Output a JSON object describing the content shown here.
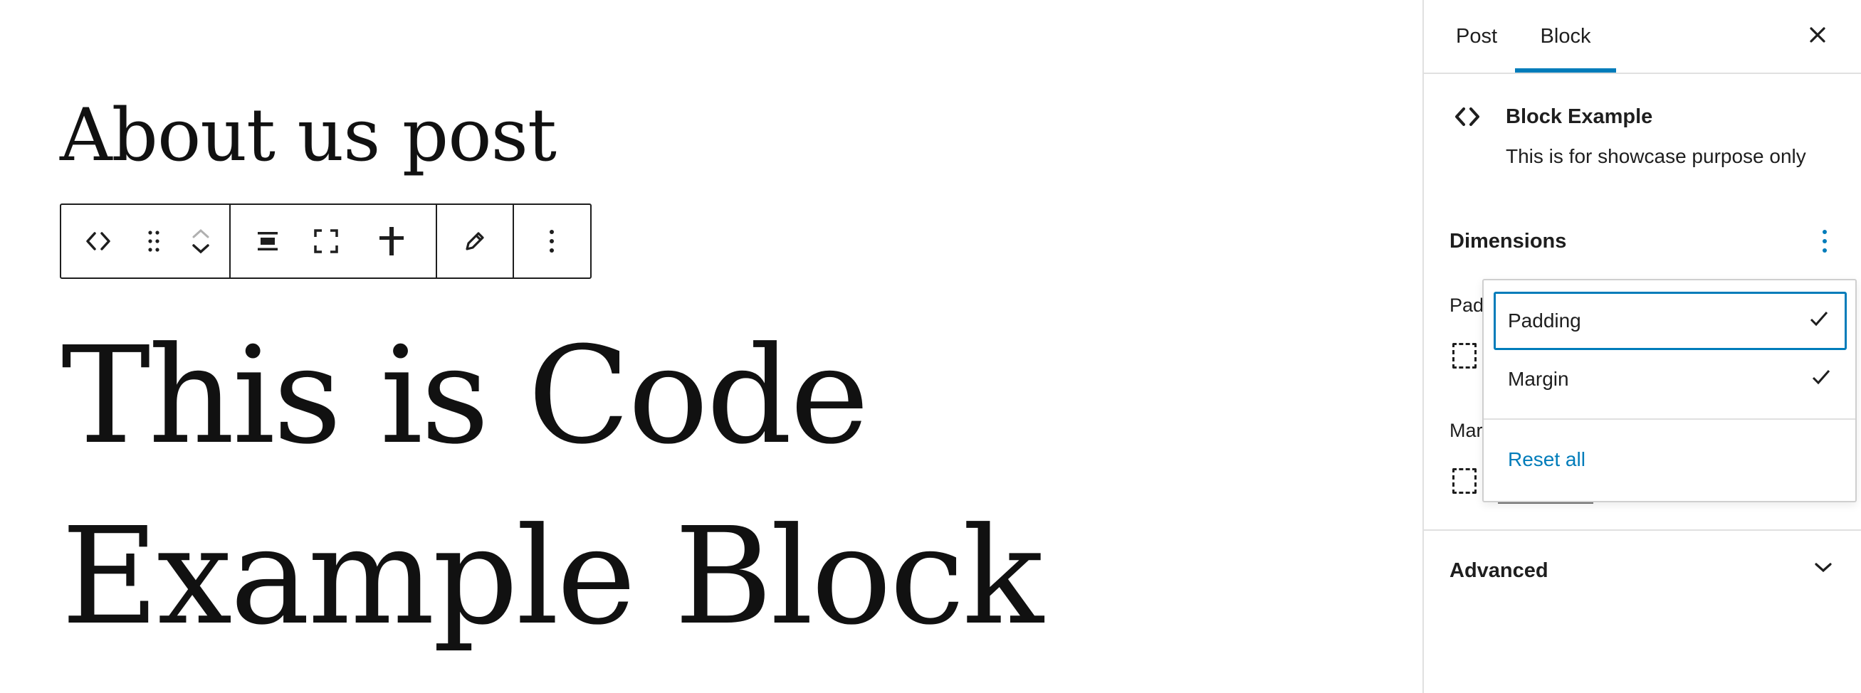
{
  "editor": {
    "post_title": "About us post",
    "heading_text": "This is Code Example Block"
  },
  "toolbar": {
    "buttons": [
      {
        "name": "block-type",
        "icon": "code-icon"
      },
      {
        "name": "drag",
        "icon": "drag-handle-icon"
      },
      {
        "name": "move",
        "icon": "chevron-up-down-icon"
      },
      {
        "name": "align",
        "icon": "align-center-icon"
      },
      {
        "name": "full-width",
        "icon": "fullscreen-icon"
      },
      {
        "name": "justify",
        "icon": "justify-icon"
      },
      {
        "name": "edit",
        "icon": "pencil-icon"
      },
      {
        "name": "options",
        "icon": "more-vertical-icon"
      }
    ]
  },
  "sidebar": {
    "tabs": [
      {
        "label": "Post",
        "active": false
      },
      {
        "label": "Block",
        "active": true
      }
    ],
    "close_icon": "close-icon",
    "block_card": {
      "icon": "code-icon",
      "title": "Block Example",
      "description": "This is for showcase purpose only"
    },
    "dimensions": {
      "title": "Dimensions",
      "menu_icon": "more-vertical-icon",
      "padding_label_partial": "Pad",
      "margin_label_partial": "Mar"
    },
    "advanced": {
      "title": "Advanced",
      "icon": "chevron-down-icon"
    }
  },
  "dropdown": {
    "items": [
      {
        "label": "Padding",
        "checked": true,
        "focused": true
      },
      {
        "label": "Margin",
        "checked": true,
        "focused": false
      }
    ],
    "reset_label": "Reset all",
    "check_icon": "check-icon"
  },
  "colors": {
    "accent": "#007cba",
    "text": "#1e1e1e",
    "border": "#e0e0e0"
  }
}
